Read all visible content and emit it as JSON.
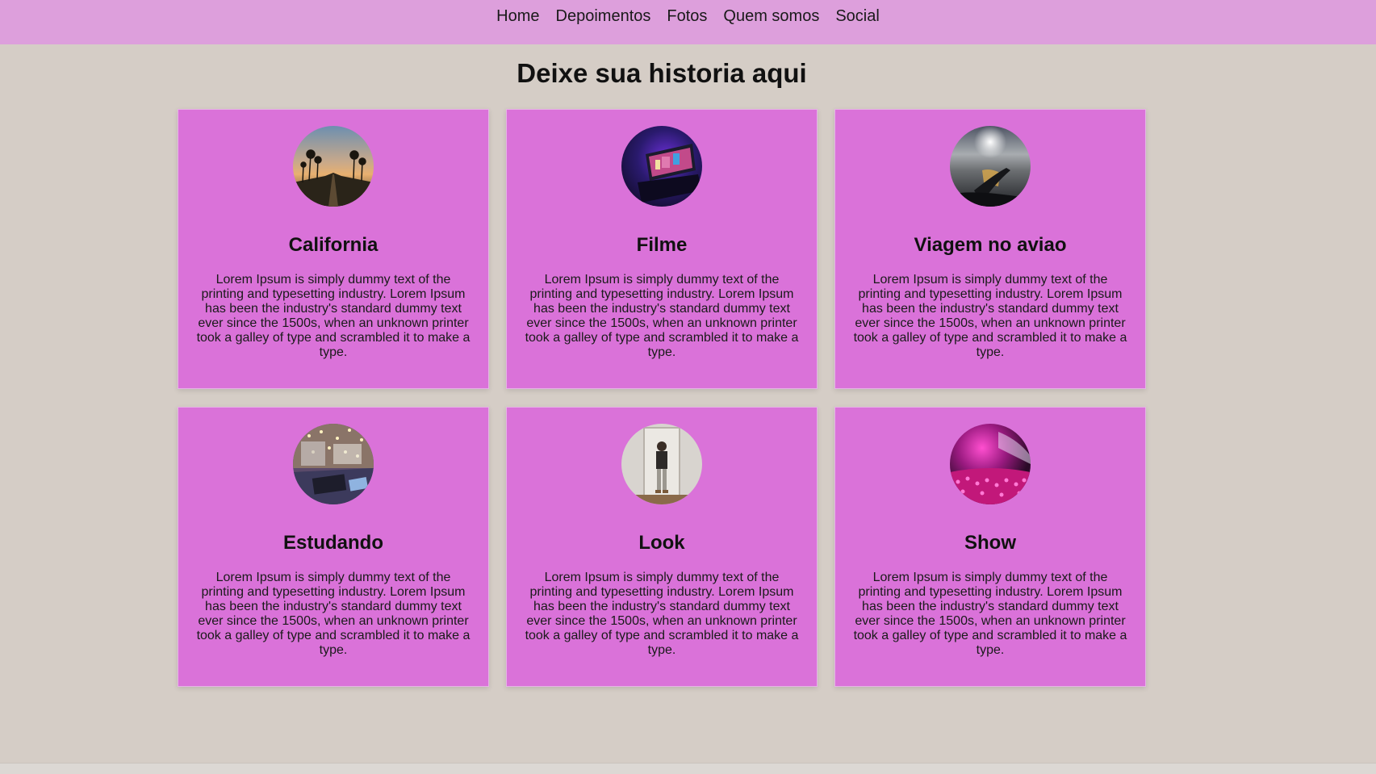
{
  "nav": {
    "items": [
      {
        "label": "Home"
      },
      {
        "label": "Depoimentos"
      },
      {
        "label": "Fotos"
      },
      {
        "label": "Quem somos"
      },
      {
        "label": "Social"
      }
    ]
  },
  "main": {
    "title": "Deixe sua historia aqui",
    "cards": [
      {
        "title": "California",
        "text": "Lorem Ipsum is simply dummy text of the printing and typesetting industry. Lorem Ipsum has been the industry's standard dummy text ever since the 1500s, when an unknown printer took a galley of type and scrambled it to make a type.",
        "image": "palm-road-sunset-photo"
      },
      {
        "title": "Filme",
        "text": "Lorem Ipsum is simply dummy text of the printing and typesetting industry. Lorem Ipsum has been the industry's standard dummy text ever since the 1500s, when an unknown printer took a galley of type and scrambled it to make a type.",
        "image": "tv-purple-light-photo"
      },
      {
        "title": "Viagem no aviao",
        "text": "Lorem Ipsum is simply dummy text of the printing and typesetting industry. Lorem Ipsum has been the industry's standard dummy text ever since the 1500s, when an unknown printer took a galley of type and scrambled it to make a type.",
        "image": "airplane-wing-sky-photo"
      },
      {
        "title": "Estudando",
        "text": "Lorem Ipsum is simply dummy text of the printing and typesetting industry. Lorem Ipsum has been the industry's standard dummy text ever since the 1500s, when an unknown printer took a galley of type and scrambled it to make a type.",
        "image": "desk-study-lights-photo"
      },
      {
        "title": "Look",
        "text": "Lorem Ipsum is simply dummy text of the printing and typesetting industry. Lorem Ipsum has been the industry's standard dummy text ever since the 1500s, when an unknown printer took a galley of type and scrambled it to make a type.",
        "image": "mirror-outfit-photo"
      },
      {
        "title": "Show",
        "text": "Lorem Ipsum is simply dummy text of the printing and typesetting industry. Lorem Ipsum has been the industry's standard dummy text ever since the 1500s, when an unknown printer took a galley of type and scrambled it to make a type.",
        "image": "concert-pink-lights-photo"
      }
    ]
  },
  "colors": {
    "background": "#d5cdc6",
    "navbar": "#dd9fdc",
    "card": "#da72d9"
  }
}
